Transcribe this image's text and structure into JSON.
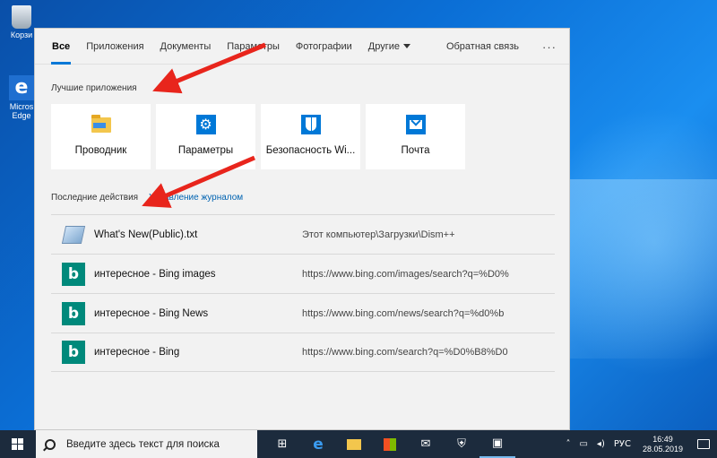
{
  "desktop": {
    "icons": [
      {
        "label": "Корзи",
        "icon": "recycle-bin-icon"
      },
      {
        "label": "Micros Edge",
        "icon": "edge-icon"
      }
    ]
  },
  "search_panel": {
    "tabs": [
      {
        "label": "Все",
        "active": true
      },
      {
        "label": "Приложения"
      },
      {
        "label": "Документы"
      },
      {
        "label": "Параметры"
      },
      {
        "label": "Фотографии"
      },
      {
        "label": "Другие",
        "dropdown": true
      }
    ],
    "feedback_label": "Обратная связь",
    "more_label": "···",
    "best_apps_title": "Лучшие приложения",
    "apps": [
      {
        "label": "Проводник",
        "icon": "file-explorer-icon"
      },
      {
        "label": "Параметры",
        "icon": "settings-gear-icon"
      },
      {
        "label": "Безопасность Wi...",
        "icon": "security-shield-icon"
      },
      {
        "label": "Почта",
        "icon": "mail-icon"
      }
    ],
    "recent_title": "Последние действия",
    "history_link": "Управление журналом",
    "recent": [
      {
        "name": "What's New(Public).txt",
        "path": "Этот компьютер\\Загрузки\\Dism++",
        "icon": "text-file-icon"
      },
      {
        "name": "интересное - Bing images",
        "path": "https://www.bing.com/images/search?q=%D0%",
        "icon": "bing-icon"
      },
      {
        "name": "интересное - Bing News",
        "path": "https://www.bing.com/news/search?q=%d0%b",
        "icon": "bing-icon"
      },
      {
        "name": "интересное - Bing",
        "path": "https://www.bing.com/search?q=%D0%B8%D0",
        "icon": "bing-icon"
      }
    ],
    "accent_color": "#0078d7",
    "arrow_color": "#e8251c"
  },
  "taskbar": {
    "search_placeholder": "Введите здесь текст для поиска",
    "apps": [
      "task-view-icon",
      "edge-icon",
      "file-explorer-icon",
      "store-icon",
      "mail-icon",
      "security-shield-icon",
      "photos-icon"
    ],
    "tray": {
      "language": "РУС",
      "time": "16:49",
      "date": "28.05.2019"
    }
  }
}
